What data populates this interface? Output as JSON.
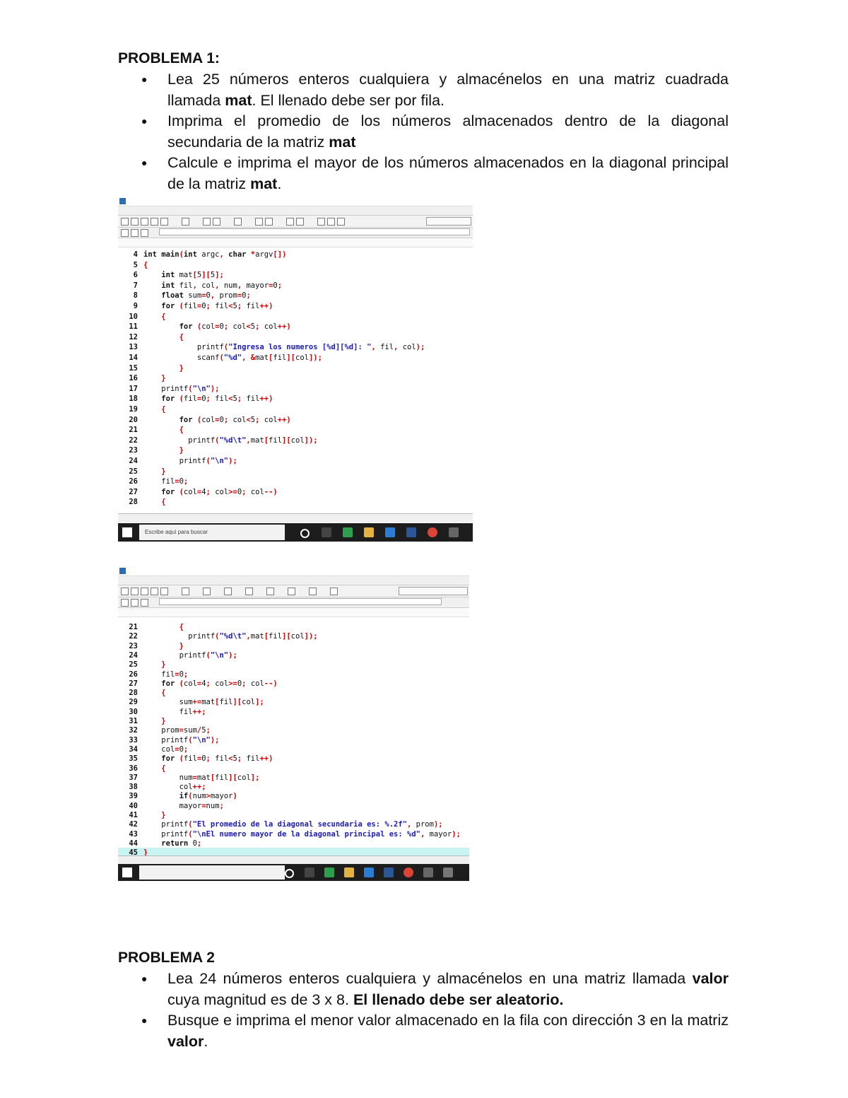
{
  "problem1": {
    "heading": "PROBLEMA 1:",
    "bullets": [
      {
        "parts": [
          [
            "Lea 25 números enteros cualquiera y almacénelos en una matriz cuadrada llamada ",
            false
          ],
          [
            "mat",
            true
          ],
          [
            ".  El llenado debe ser por fila.",
            false
          ]
        ]
      },
      {
        "parts": [
          [
            "Imprima el promedio de los números almacenados dentro de la diagonal secundaria de la matriz ",
            false
          ],
          [
            "mat",
            true
          ]
        ]
      },
      {
        "parts": [
          [
            "Calcule e imprima el mayor de los números almacenados en la diagonal principal de la matriz ",
            false
          ],
          [
            "mat",
            true
          ],
          [
            ".",
            false
          ]
        ]
      }
    ]
  },
  "screenshot1": {
    "taskbar_search": "Escribe aquí para buscar",
    "lines": [
      {
        "n": "4",
        "t": "int main(int argc, char *argv[])"
      },
      {
        "n": "5",
        "t": "{"
      },
      {
        "n": "6",
        "t": "    int mat[5][5];"
      },
      {
        "n": "7",
        "t": "    int fil, col, num, mayor=0;"
      },
      {
        "n": "8",
        "t": "    float sum=0, prom=0;"
      },
      {
        "n": "9",
        "t": "    for (fil=0; fil<5; fil++)"
      },
      {
        "n": "10",
        "t": "    {"
      },
      {
        "n": "11",
        "t": "        for (col=0; col<5; col++)"
      },
      {
        "n": "12",
        "t": "        {"
      },
      {
        "n": "13",
        "t": "            printf(\"Ingresa los numeros [%d][%d]: \", fil, col);"
      },
      {
        "n": "14",
        "t": "            scanf(\"%d\", &mat[fil][col]);"
      },
      {
        "n": "15",
        "t": "        }"
      },
      {
        "n": "16",
        "t": "    }"
      },
      {
        "n": "17",
        "t": "    printf(\"\\n\");"
      },
      {
        "n": "18",
        "t": "    for (fil=0; fil<5; fil++)"
      },
      {
        "n": "19",
        "t": "    {"
      },
      {
        "n": "20",
        "t": "        for (col=0; col<5; col++)"
      },
      {
        "n": "21",
        "t": "        {"
      },
      {
        "n": "22",
        "t": "          printf(\"%d\\t\",mat[fil][col]);"
      },
      {
        "n": "23",
        "t": "        }"
      },
      {
        "n": "24",
        "t": "        printf(\"\\n\");"
      },
      {
        "n": "25",
        "t": "    }"
      },
      {
        "n": "26",
        "t": "    fil=0;"
      },
      {
        "n": "27",
        "t": "    for (col=4; col>=0; col--)"
      },
      {
        "n": "28",
        "t": "    {"
      }
    ]
  },
  "screenshot2": {
    "lines": [
      {
        "n": "21",
        "t": "        {"
      },
      {
        "n": "22",
        "t": "          printf(\"%d\\t\",mat[fil][col]);"
      },
      {
        "n": "23",
        "t": "        }"
      },
      {
        "n": "24",
        "t": "        printf(\"\\n\");"
      },
      {
        "n": "25",
        "t": "    }"
      },
      {
        "n": "26",
        "t": "    fil=0;"
      },
      {
        "n": "27",
        "t": "    for (col=4; col>=0; col--)"
      },
      {
        "n": "28",
        "t": "    {"
      },
      {
        "n": "29",
        "t": "        sum+=mat[fil][col];"
      },
      {
        "n": "30",
        "t": "        fil++;"
      },
      {
        "n": "31",
        "t": "    }"
      },
      {
        "n": "32",
        "t": "    prom=sum/5;"
      },
      {
        "n": "33",
        "t": "    printf(\"\\n\");"
      },
      {
        "n": "34",
        "t": "    col=0;"
      },
      {
        "n": "35",
        "t": "    for (fil=0; fil<5; fil++)"
      },
      {
        "n": "36",
        "t": "    {"
      },
      {
        "n": "37",
        "t": "        num=mat[fil][col];"
      },
      {
        "n": "38",
        "t": "        col++;"
      },
      {
        "n": "39",
        "t": "        if(num>mayor)"
      },
      {
        "n": "40",
        "t": "        mayor=num;"
      },
      {
        "n": "41",
        "t": "    }"
      },
      {
        "n": "42",
        "t": "    printf(\"El promedio de la diagonal secundaria es: %.2f\", prom);"
      },
      {
        "n": "43",
        "t": "    printf(\"\\nEl numero mayor de la diagonal principal es: %d\", mayor);"
      },
      {
        "n": "44",
        "t": "    return 0;"
      },
      {
        "n": "45",
        "t": "}"
      }
    ]
  },
  "problem2": {
    "heading": "PROBLEMA 2",
    "bullets": [
      {
        "parts": [
          [
            "Lea 24 números enteros cualquiera y almacénelos en una matriz llamada ",
            false
          ],
          [
            "valor",
            true
          ],
          [
            " cuya magnitud es de 3 x 8. ",
            false
          ],
          [
            "El llenado debe ser aleatorio.",
            true
          ]
        ]
      },
      {
        "parts": [
          [
            "Busque e imprima el menor valor almacenado en la fila con dirección 3 en la matriz ",
            false
          ],
          [
            "valor",
            true
          ],
          [
            ".",
            false
          ]
        ]
      }
    ]
  }
}
